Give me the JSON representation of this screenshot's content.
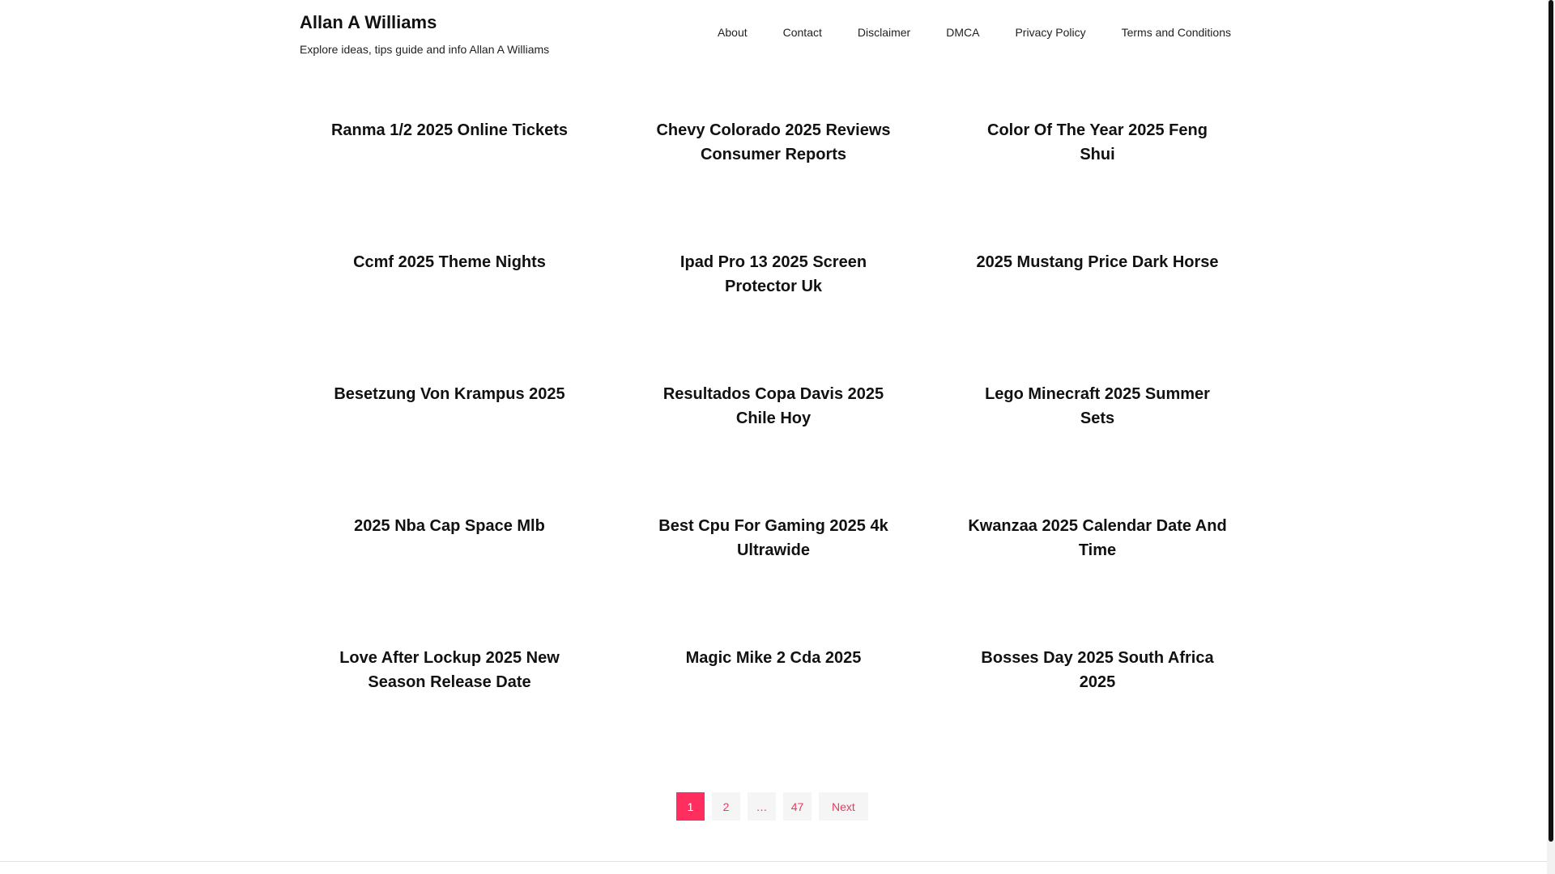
{
  "site": {
    "title": "Allan A Williams",
    "description": "Explore ideas, tips guide and info Allan A Williams"
  },
  "nav": {
    "items": [
      "About",
      "Contact",
      "Disclaimer",
      "DMCA",
      "Privacy Policy",
      "Terms and Conditions"
    ]
  },
  "posts": [
    "Ranma 1/2 2025 Online Tickets",
    "Chevy Colorado 2025 Reviews Consumer Reports",
    "Color Of The Year 2025 Feng Shui",
    "Ccmf 2025 Theme Nights",
    "Ipad Pro 13 2025 Screen Protector Uk",
    "2025 Mustang Price Dark Horse",
    "Besetzung Von Krampus 2025",
    "Resultados Copa Davis 2025 Chile Hoy",
    "Lego Minecraft 2025 Summer Sets",
    "2025 Nba Cap Space Mlb",
    "Best Cpu For Gaming 2025 4k Ultrawide",
    "Kwanzaa 2025 Calendar Date And Time",
    "Love After Lockup 2025 New Season Release Date",
    "Magic Mike 2 Cda 2025",
    "Bosses Day 2025 South Africa 2025"
  ],
  "pagination": {
    "current": "1",
    "page2": "2",
    "dots": "…",
    "last": "47",
    "next": "Next"
  },
  "colors": {
    "accent": "#ff2e5f",
    "link": "#e83a5f"
  }
}
